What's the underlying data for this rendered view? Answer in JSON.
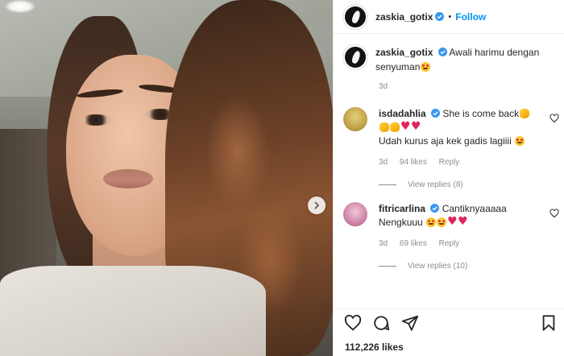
{
  "post": {
    "username": "zaskia_gotix",
    "follow_label": "Follow",
    "separator": "•",
    "caption": "Awali harimu dengan senyuman",
    "caption_time": "3d",
    "likes": "112,226 likes"
  },
  "comments": [
    {
      "username": "isdadahlia",
      "line1": "She is come back",
      "line2": "Udah kurus aja kek gadis lagiiii",
      "time": "3d",
      "likes": "94 likes",
      "reply_label": "Reply",
      "view_replies": "View replies (8)",
      "avatar_color": "#c9b15a"
    },
    {
      "username": "fitricarlina",
      "line1": "Cantiknyaaaaa",
      "line2": "Nengkuuu",
      "time": "3d",
      "likes": "69 likes",
      "reply_label": "Reply",
      "view_replies": "View replies (10)",
      "avatar_color": "#d89ab8"
    }
  ],
  "icons": {
    "verified": "verified-badge-icon",
    "like": "heart-icon",
    "comment": "comment-icon",
    "share": "paper-plane-icon",
    "save": "bookmark-icon",
    "next": "chevron-right-icon"
  },
  "colors": {
    "accent": "#0095f6",
    "verified": "#3897f0",
    "muted": "#8e8e8e"
  }
}
